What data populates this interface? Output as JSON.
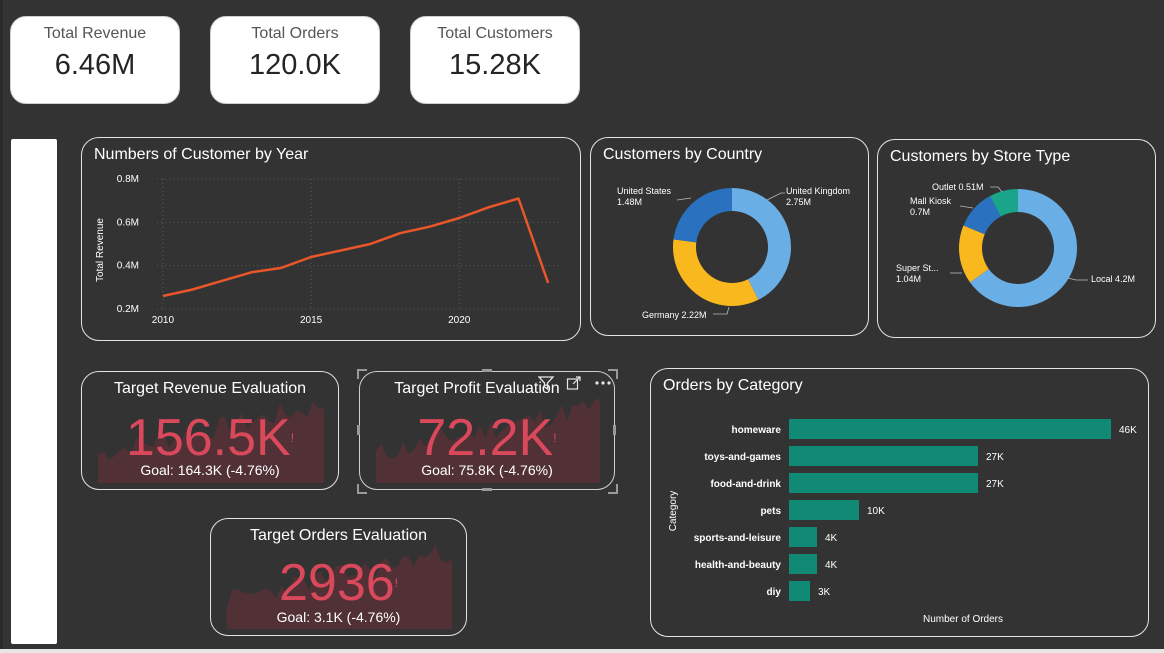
{
  "kpis": [
    {
      "label": "Total Revenue",
      "value": "6.46M"
    },
    {
      "label": "Total Orders",
      "value": "120.0K"
    },
    {
      "label": "Total Customers",
      "value": "15.28K"
    }
  ],
  "line_chart": {
    "title": "Numbers of Customer by Year"
  },
  "country_chart": {
    "title": "Customers by Country"
  },
  "store_chart": {
    "title": "Customers by Store Type"
  },
  "category_chart": {
    "title": "Orders by Category"
  },
  "evaluations": [
    {
      "title": "Target Revenue Evaluation",
      "value": "156.5K",
      "goal": "Goal: 164.3K (-4.76%)",
      "mark": "!"
    },
    {
      "title": "Target Profit Evaluation",
      "value": "72.2K",
      "goal": "Goal: 75.8K (-4.76%)",
      "mark": "!"
    },
    {
      "title": "Target Orders Evaluation",
      "value": "2936",
      "goal": "Goal: 3.1K (-4.76%)",
      "mark": "!"
    }
  ],
  "toolbar": {
    "filter_icon": "filter-icon",
    "focus_icon": "focus-mode-icon",
    "more_icon": "more-options-icon"
  },
  "colors": {
    "background": "#333333",
    "line": "#e8562a",
    "bar": "#118a75",
    "alert": "#d9485b",
    "donut_light_blue": "#6aaee6",
    "donut_blue": "#2a72c0",
    "donut_yellow": "#f8b81e",
    "donut_teal": "#1aa58a"
  },
  "chart_data": [
    {
      "type": "line",
      "title": "Numbers of Customer by Year",
      "xlabel": "",
      "ylabel": "Total Revenue",
      "x": [
        2010,
        2011,
        2012,
        2013,
        2014,
        2015,
        2016,
        2017,
        2018,
        2019,
        2020,
        2021,
        2022,
        2023
      ],
      "series": [
        {
          "values": [
            0.26,
            0.29,
            0.33,
            0.37,
            0.39,
            0.44,
            0.47,
            0.5,
            0.55,
            0.58,
            0.62,
            0.67,
            0.71,
            0.32
          ]
        }
      ],
      "xticks": [
        "2010",
        "2015",
        "2020"
      ],
      "yticks": [
        "0.2M",
        "0.4M",
        "0.6M",
        "0.8M"
      ],
      "xlim": [
        2009.8,
        2023.4
      ],
      "ylim": [
        0.2,
        0.8
      ],
      "grid": true
    },
    {
      "type": "pie",
      "title": "Customers by Country",
      "categories": [
        "United Kingdom",
        "Germany",
        "United States"
      ],
      "values": [
        2.75,
        2.22,
        1.48
      ],
      "labels": [
        "United Kingdom 2.75M",
        "Germany 2.22M",
        "United States 1.48M"
      ]
    },
    {
      "type": "pie",
      "title": "Customers by Store Type",
      "categories": [
        "Local",
        "Super Store",
        "Mall Kiosk",
        "Outlet"
      ],
      "values": [
        4.2,
        1.04,
        0.7,
        0.51
      ],
      "labels": [
        "Local 4.2M",
        "Super St... 1.04M",
        "Mall Kiosk 0.7M",
        "Outlet 0.51M"
      ]
    },
    {
      "type": "bar",
      "title": "Orders by Category",
      "xlabel": "Number of Orders",
      "ylabel": "Category",
      "categories": [
        "homeware",
        "toys-and-games",
        "food-and-drink",
        "pets",
        "sports-and-leisure",
        "health-and-beauty",
        "diy"
      ],
      "values": [
        46,
        27,
        27,
        10,
        4,
        4,
        3
      ],
      "labels": [
        "46K",
        "27K",
        "27K",
        "10K",
        "4K",
        "4K",
        "3K"
      ]
    }
  ]
}
